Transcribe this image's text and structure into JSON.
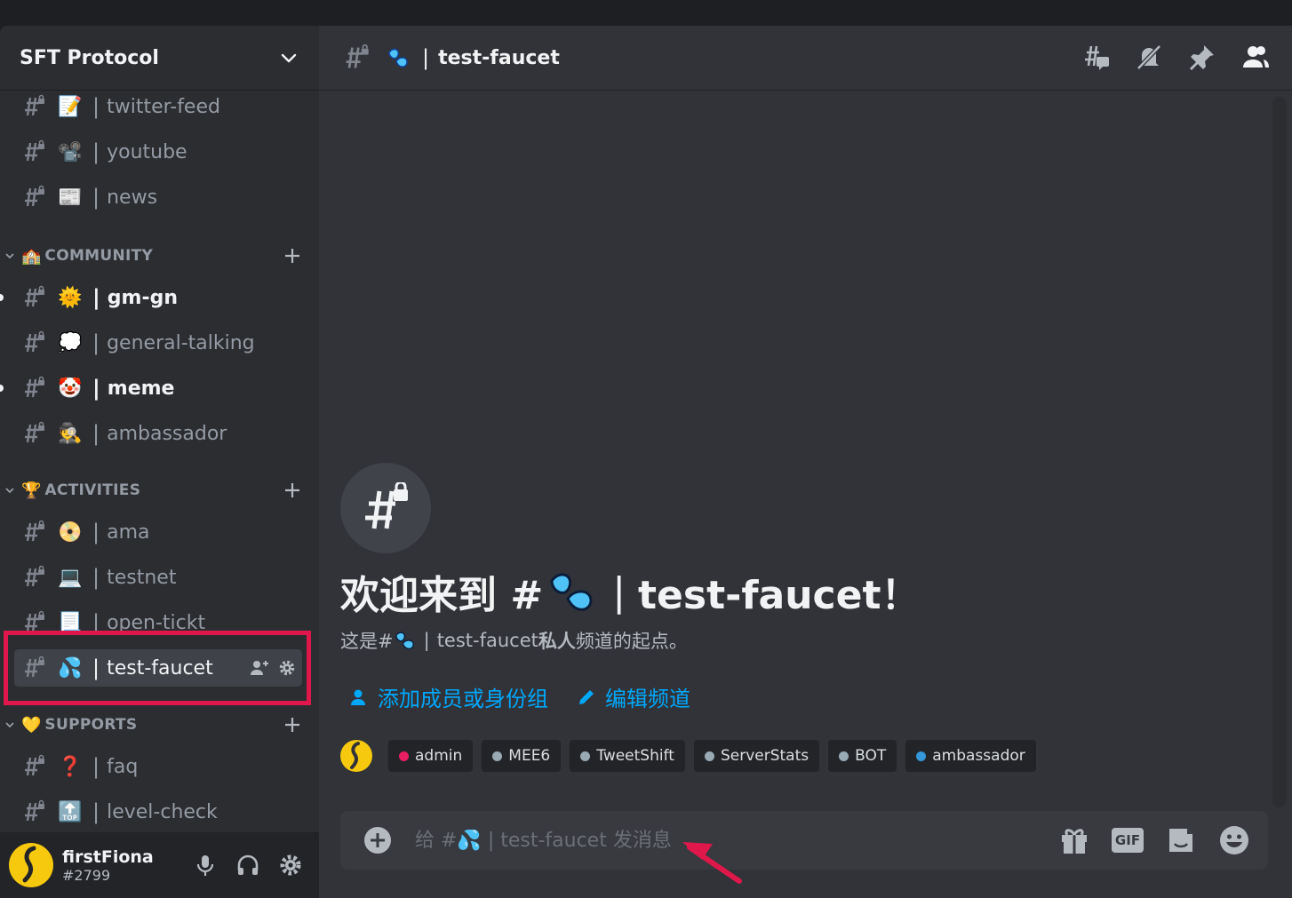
{
  "server": {
    "name": "SFT Protocol"
  },
  "channels_top": [
    {
      "name": "twitter-feed",
      "emoji": "📝",
      "unread": false
    },
    {
      "name": "youtube",
      "emoji": "📽️",
      "unread": false
    },
    {
      "name": "news",
      "emoji": "📰",
      "unread": false
    }
  ],
  "categories": {
    "community": {
      "label": "COMMUNITY",
      "emoji": "🏫"
    },
    "activities": {
      "label": "ACTIVITIES",
      "emoji": "🏆"
    },
    "supports": {
      "label": "SUPPORTS",
      "emoji": "💛"
    }
  },
  "community_channels": [
    {
      "name": "gm-gn",
      "emoji": "🌞",
      "unread": true
    },
    {
      "name": "general-talking",
      "emoji": "💭",
      "unread": false
    },
    {
      "name": "meme",
      "emoji": "🤡",
      "unread": true
    },
    {
      "name": "ambassador",
      "emoji": "🕵️",
      "unread": false
    }
  ],
  "activities_channels": [
    {
      "name": "ama",
      "emoji": "📀",
      "unread": false
    },
    {
      "name": "testnet",
      "emoji": "💻",
      "unread": false
    },
    {
      "name": "open-tickt",
      "emoji": "📃",
      "unread": false
    },
    {
      "name": "test-faucet",
      "emoji": "💦",
      "unread": false,
      "active": true
    }
  ],
  "supports_channels": [
    {
      "name": "faq",
      "emoji": "❓",
      "unread": false
    },
    {
      "name": "level-check",
      "emoji": "🔝",
      "unread": false
    }
  ],
  "separator": "|",
  "user": {
    "name": "firstFiona",
    "tag": "#2799"
  },
  "channel_header": {
    "title": "test-faucet",
    "emoji": "💦"
  },
  "welcome": {
    "title_prefix": "欢迎来到 #",
    "title_suffix": "test-faucet！",
    "sub_prefix": "这是#",
    "sub_channel": "test-faucet",
    "sub_bold": "私人",
    "sub_suffix": "频道的起点。"
  },
  "actions": {
    "add_members": "添加成员或身份组",
    "edit_channel": "编辑频道"
  },
  "roles": [
    {
      "name": "admin",
      "color": "#e91e63"
    },
    {
      "name": "MEE6",
      "color": "#99aab5"
    },
    {
      "name": "TweetShift",
      "color": "#99aab5"
    },
    {
      "name": "ServerStats",
      "color": "#99aab5"
    },
    {
      "name": "BOT",
      "color": "#99aab5"
    },
    {
      "name": "ambassador",
      "color": "#3498db"
    }
  ],
  "composer": {
    "placeholder": "给 #💦 | test-faucet 发消息",
    "gif_label": "GIF"
  },
  "colors": {
    "accent": "#00a8fc",
    "highlight": "#e0174a",
    "arrow": "#e0174a"
  }
}
